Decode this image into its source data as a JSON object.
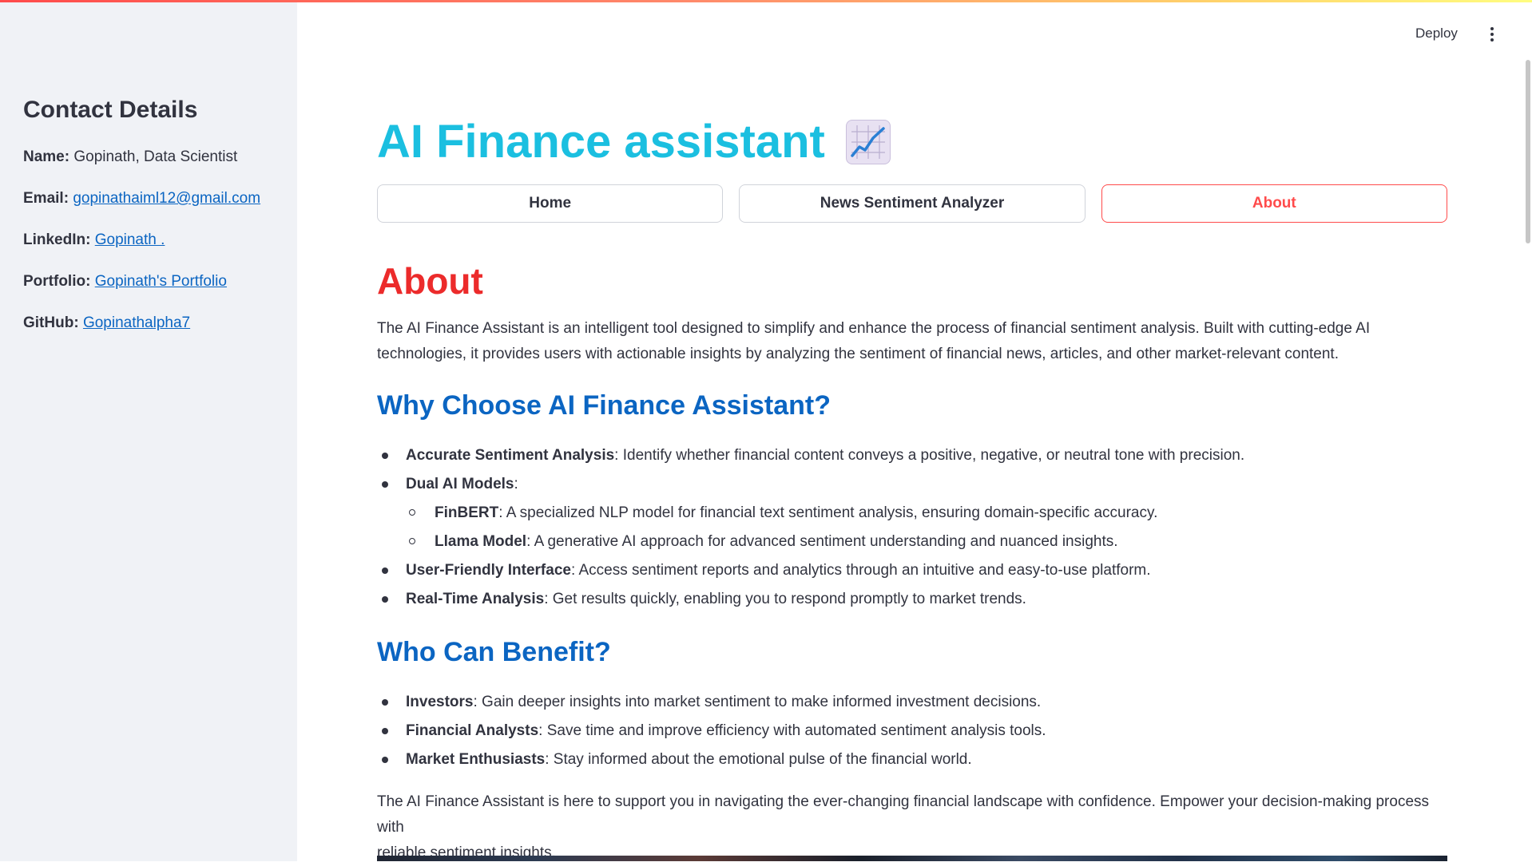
{
  "header": {
    "deploy_label": "Deploy"
  },
  "sidebar": {
    "title": "Contact Details",
    "contacts": [
      {
        "label": "Name:",
        "value": "Gopinath, Data Scientist",
        "is_link": false
      },
      {
        "label": "Email:",
        "value": "gopinathaiml12@gmail.com",
        "is_link": true
      },
      {
        "label": "LinkedIn:",
        "value": "Gopinath .",
        "is_link": true
      },
      {
        "label": "Portfolio:",
        "value": "Gopinath's Portfolio",
        "is_link": true
      },
      {
        "label": "GitHub:",
        "value": "Gopinathalpha7",
        "is_link": true
      }
    ]
  },
  "main": {
    "title": "AI Finance assistant",
    "title_icon": "chart-increasing-icon",
    "tabs": [
      {
        "label": "Home",
        "active": false
      },
      {
        "label": "News Sentiment Analyzer",
        "active": false
      },
      {
        "label": "About",
        "active": true
      }
    ],
    "about": {
      "heading": "About",
      "intro_line1": "The AI Finance Assistant is an intelligent tool designed to simplify and enhance the process of financial sentiment analysis. Built with cutting-edge AI",
      "intro_line2": "technologies, it provides users with actionable insights by analyzing the sentiment of financial news, articles, and other market-relevant content.",
      "why_heading": "Why Choose AI Finance Assistant?",
      "why_items": [
        {
          "bold": "Accurate Sentiment Analysis",
          "text": ": Identify whether financial content conveys a positive, negative, or neutral tone with precision."
        },
        {
          "bold": "Dual AI Models",
          "text": ":"
        },
        {
          "bold": "FinBERT",
          "text": ": A specialized NLP model for financial text sentiment analysis, ensuring domain-specific accuracy."
        },
        {
          "bold": "Llama Model",
          "text": ": A generative AI approach for advanced sentiment understanding and nuanced insights."
        },
        {
          "bold": "User-Friendly Interface",
          "text": ": Access sentiment reports and analytics through an intuitive and easy-to-use platform."
        },
        {
          "bold": "Real-Time Analysis",
          "text": ": Get results quickly, enabling you to respond promptly to market trends."
        }
      ],
      "benefit_heading": "Who Can Benefit?",
      "benefit_items": [
        {
          "bold": "Investors",
          "text": ": Gain deeper insights into market sentiment to make informed investment decisions."
        },
        {
          "bold": "Financial Analysts",
          "text": ": Save time and improve efficiency with automated sentiment analysis tools."
        },
        {
          "bold": "Market Enthusiasts",
          "text": ": Stay informed about the emotional pulse of the financial world."
        }
      ],
      "outro_line1": "The AI Finance Assistant is here to support you in navigating the ever-changing financial landscape with confidence. Empower your decision-making process with",
      "outro_line2": "reliable sentiment insights."
    }
  },
  "colors": {
    "title": "#1bbfe0",
    "about_heading": "#ec2b2b",
    "section_heading": "#0b65c2",
    "active_tab": "#ff4b4b",
    "sidebar_bg": "#f0f2f6"
  }
}
